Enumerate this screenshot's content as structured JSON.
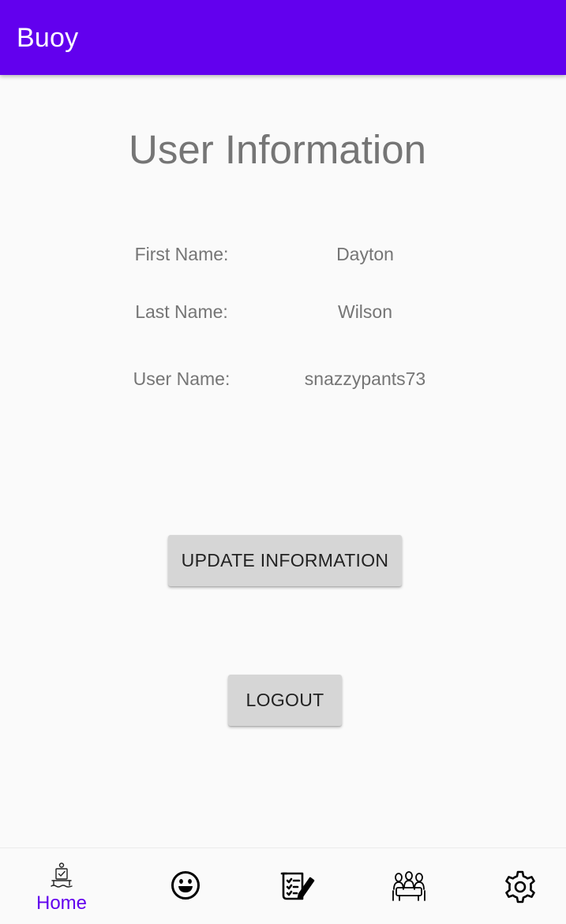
{
  "app_bar": {
    "title": "Buoy"
  },
  "main": {
    "title": "User Information",
    "fields": [
      {
        "label": "First Name:",
        "value": "Dayton"
      },
      {
        "label": "Last Name:",
        "value": "Wilson"
      },
      {
        "label": "User Name:",
        "value": "snazzypants73"
      }
    ],
    "update_button_label": "UPDATE INFORMATION",
    "logout_button_label": "LOGOUT"
  },
  "bottom_nav": {
    "items": [
      {
        "icon": "home-icon",
        "label": "Home",
        "selected": true
      },
      {
        "icon": "smiley-face-icon",
        "label": "",
        "selected": false
      },
      {
        "icon": "journal-checklist-icon",
        "label": "",
        "selected": false
      },
      {
        "icon": "community-people-icon",
        "label": "",
        "selected": false
      },
      {
        "icon": "gear-icon",
        "label": "",
        "selected": false
      }
    ]
  },
  "colors": {
    "primary": "#6200ee",
    "text_secondary": "#757575",
    "button_bg": "#d6d6d6",
    "background": "#fafafa"
  }
}
